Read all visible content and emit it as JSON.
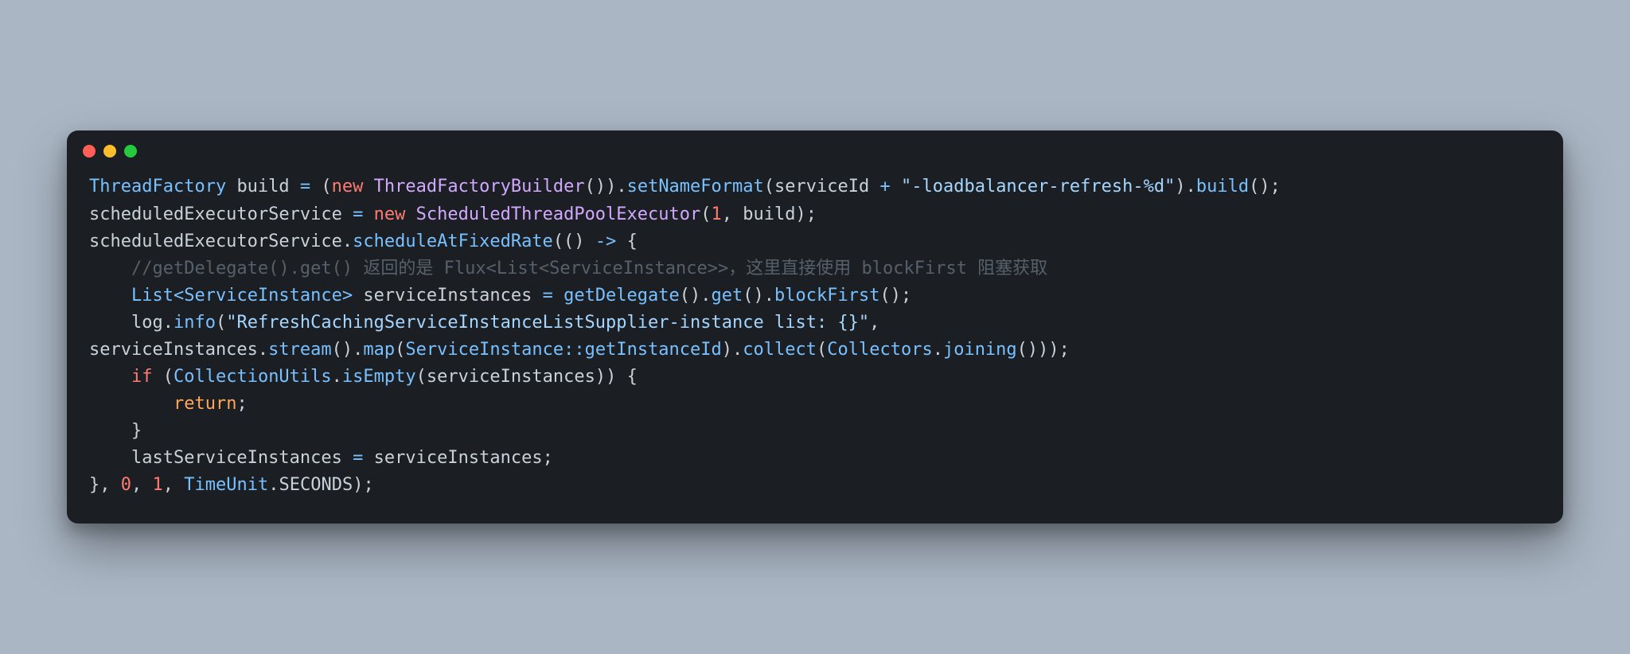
{
  "code": {
    "tokens": [
      {
        "t": "ThreadFactory",
        "c": "c-type"
      },
      {
        "t": " ",
        "c": "c-ident"
      },
      {
        "t": "build",
        "c": "c-ident"
      },
      {
        "t": " ",
        "c": "c-ident"
      },
      {
        "t": "=",
        "c": "c-op"
      },
      {
        "t": " ",
        "c": "c-ident"
      },
      {
        "t": "(",
        "c": "c-paren"
      },
      {
        "t": "new",
        "c": "c-keyword"
      },
      {
        "t": " ",
        "c": "c-ident"
      },
      {
        "t": "ThreadFactoryBuilder",
        "c": "c-ctor"
      },
      {
        "t": "()",
        "c": "c-paren"
      },
      {
        "t": ")",
        "c": "c-paren"
      },
      {
        "t": ".",
        "c": "c-dot"
      },
      {
        "t": "setNameFormat",
        "c": "c-call"
      },
      {
        "t": "(",
        "c": "c-paren"
      },
      {
        "t": "serviceId",
        "c": "c-ident"
      },
      {
        "t": " ",
        "c": "c-ident"
      },
      {
        "t": "+",
        "c": "c-op"
      },
      {
        "t": " ",
        "c": "c-ident"
      },
      {
        "t": "\"-loadbalancer-refresh-%d\"",
        "c": "c-string"
      },
      {
        "t": ")",
        "c": "c-paren"
      },
      {
        "t": ".",
        "c": "c-dot"
      },
      {
        "t": "build",
        "c": "c-call"
      },
      {
        "t": "()",
        "c": "c-paren"
      },
      {
        "t": ";",
        "c": "c-punct"
      },
      {
        "t": "\n",
        "c": ""
      },
      {
        "t": "scheduledExecutorService",
        "c": "c-ident"
      },
      {
        "t": " ",
        "c": "c-ident"
      },
      {
        "t": "=",
        "c": "c-op"
      },
      {
        "t": " ",
        "c": "c-ident"
      },
      {
        "t": "new",
        "c": "c-keyword"
      },
      {
        "t": " ",
        "c": "c-ident"
      },
      {
        "t": "ScheduledThreadPoolExecutor",
        "c": "c-ctor"
      },
      {
        "t": "(",
        "c": "c-paren"
      },
      {
        "t": "1",
        "c": "c-num"
      },
      {
        "t": ",",
        "c": "c-punct"
      },
      {
        "t": " ",
        "c": "c-ident"
      },
      {
        "t": "build",
        "c": "c-ident"
      },
      {
        "t": ")",
        "c": "c-paren"
      },
      {
        "t": ";",
        "c": "c-punct"
      },
      {
        "t": "\n",
        "c": ""
      },
      {
        "t": "scheduledExecutorService",
        "c": "c-ident"
      },
      {
        "t": ".",
        "c": "c-dot"
      },
      {
        "t": "scheduleAtFixedRate",
        "c": "c-call"
      },
      {
        "t": "(()",
        "c": "c-paren"
      },
      {
        "t": " ",
        "c": "c-ident"
      },
      {
        "t": "->",
        "c": "c-op"
      },
      {
        "t": " ",
        "c": "c-ident"
      },
      {
        "t": "{",
        "c": "c-paren"
      },
      {
        "t": "\n",
        "c": ""
      },
      {
        "t": "    ",
        "c": "c-ident"
      },
      {
        "t": "//getDelegate().get() 返回的是 Flux<List<ServiceInstance>>，这里直接使用 blockFirst 阻塞获取",
        "c": "c-comment"
      },
      {
        "t": "\n",
        "c": ""
      },
      {
        "t": "    ",
        "c": "c-ident"
      },
      {
        "t": "List",
        "c": "c-type"
      },
      {
        "t": "<",
        "c": "c-op"
      },
      {
        "t": "ServiceInstance",
        "c": "c-type"
      },
      {
        "t": ">",
        "c": "c-op"
      },
      {
        "t": " ",
        "c": "c-ident"
      },
      {
        "t": "serviceInstances",
        "c": "c-ident"
      },
      {
        "t": " ",
        "c": "c-ident"
      },
      {
        "t": "=",
        "c": "c-op"
      },
      {
        "t": " ",
        "c": "c-ident"
      },
      {
        "t": "getDelegate",
        "c": "c-call"
      },
      {
        "t": "()",
        "c": "c-paren"
      },
      {
        "t": ".",
        "c": "c-dot"
      },
      {
        "t": "get",
        "c": "c-call"
      },
      {
        "t": "()",
        "c": "c-paren"
      },
      {
        "t": ".",
        "c": "c-dot"
      },
      {
        "t": "blockFirst",
        "c": "c-call"
      },
      {
        "t": "()",
        "c": "c-paren"
      },
      {
        "t": ";",
        "c": "c-punct"
      },
      {
        "t": "\n",
        "c": ""
      },
      {
        "t": "    ",
        "c": "c-ident"
      },
      {
        "t": "log",
        "c": "c-ident"
      },
      {
        "t": ".",
        "c": "c-dot"
      },
      {
        "t": "info",
        "c": "c-call"
      },
      {
        "t": "(",
        "c": "c-paren"
      },
      {
        "t": "\"RefreshCachingServiceInstanceListSupplier-instance list: {}\"",
        "c": "c-string"
      },
      {
        "t": ",",
        "c": "c-punct"
      },
      {
        "t": " ",
        "c": "c-ident"
      },
      {
        "t": "serviceInstances",
        "c": "c-ident"
      },
      {
        "t": ".",
        "c": "c-dot"
      },
      {
        "t": "stream",
        "c": "c-call"
      },
      {
        "t": "()",
        "c": "c-paren"
      },
      {
        "t": ".",
        "c": "c-dot"
      },
      {
        "t": "map",
        "c": "c-call"
      },
      {
        "t": "(",
        "c": "c-paren"
      },
      {
        "t": "ServiceInstance",
        "c": "c-type"
      },
      {
        "t": "::",
        "c": "c-op"
      },
      {
        "t": "getInstanceId",
        "c": "c-call"
      },
      {
        "t": ")",
        "c": "c-paren"
      },
      {
        "t": ".",
        "c": "c-dot"
      },
      {
        "t": "collect",
        "c": "c-call"
      },
      {
        "t": "(",
        "c": "c-paren"
      },
      {
        "t": "Collectors",
        "c": "c-type"
      },
      {
        "t": ".",
        "c": "c-dot"
      },
      {
        "t": "joining",
        "c": "c-call"
      },
      {
        "t": "()",
        "c": "c-paren"
      },
      {
        "t": ")",
        "c": "c-paren"
      },
      {
        "t": ")",
        "c": "c-paren"
      },
      {
        "t": ";",
        "c": "c-punct"
      },
      {
        "t": "\n",
        "c": ""
      },
      {
        "t": "    ",
        "c": "c-ident"
      },
      {
        "t": "if",
        "c": "c-keyword"
      },
      {
        "t": " ",
        "c": "c-ident"
      },
      {
        "t": "(",
        "c": "c-paren"
      },
      {
        "t": "CollectionUtils",
        "c": "c-type"
      },
      {
        "t": ".",
        "c": "c-dot"
      },
      {
        "t": "isEmpty",
        "c": "c-call"
      },
      {
        "t": "(",
        "c": "c-paren"
      },
      {
        "t": "serviceInstances",
        "c": "c-ident"
      },
      {
        "t": ")",
        "c": "c-paren"
      },
      {
        "t": ")",
        "c": "c-paren"
      },
      {
        "t": " ",
        "c": "c-ident"
      },
      {
        "t": "{",
        "c": "c-paren"
      },
      {
        "t": "\n",
        "c": ""
      },
      {
        "t": "        ",
        "c": "c-ident"
      },
      {
        "t": "return",
        "c": "c-return"
      },
      {
        "t": ";",
        "c": "c-punct"
      },
      {
        "t": "\n",
        "c": ""
      },
      {
        "t": "    ",
        "c": "c-ident"
      },
      {
        "t": "}",
        "c": "c-paren"
      },
      {
        "t": "\n",
        "c": ""
      },
      {
        "t": "    ",
        "c": "c-ident"
      },
      {
        "t": "lastServiceInstances",
        "c": "c-ident"
      },
      {
        "t": " ",
        "c": "c-ident"
      },
      {
        "t": "=",
        "c": "c-op"
      },
      {
        "t": " ",
        "c": "c-ident"
      },
      {
        "t": "serviceInstances",
        "c": "c-ident"
      },
      {
        "t": ";",
        "c": "c-punct"
      },
      {
        "t": "\n",
        "c": ""
      },
      {
        "t": "}",
        "c": "c-paren"
      },
      {
        "t": ",",
        "c": "c-punct"
      },
      {
        "t": " ",
        "c": "c-ident"
      },
      {
        "t": "0",
        "c": "c-num"
      },
      {
        "t": ",",
        "c": "c-punct"
      },
      {
        "t": " ",
        "c": "c-ident"
      },
      {
        "t": "1",
        "c": "c-num"
      },
      {
        "t": ",",
        "c": "c-punct"
      },
      {
        "t": " ",
        "c": "c-ident"
      },
      {
        "t": "TimeUnit",
        "c": "c-type"
      },
      {
        "t": ".",
        "c": "c-dot"
      },
      {
        "t": "SECONDS",
        "c": "c-ident"
      },
      {
        "t": ")",
        "c": "c-paren"
      },
      {
        "t": ";",
        "c": "c-punct"
      }
    ]
  }
}
